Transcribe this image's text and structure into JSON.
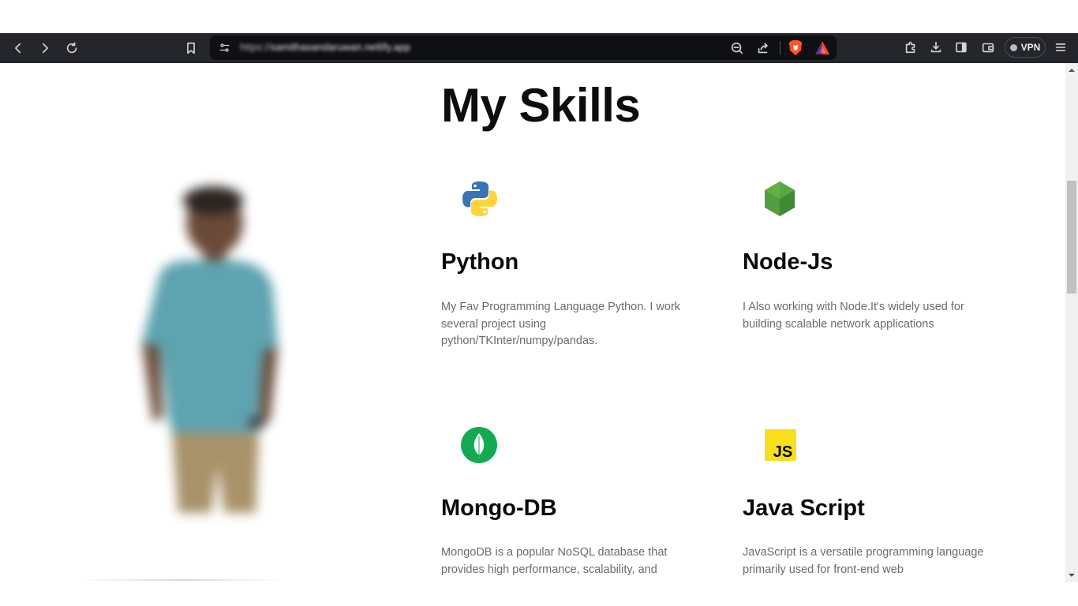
{
  "browser": {
    "url_scheme": "https://",
    "url_host": "samithasandaruwan.netlify.app",
    "vpn_label": "VPN",
    "icons": [
      "back-icon",
      "forward-icon",
      "reload-icon",
      "bookmark-icon",
      "site-settings-icon",
      "zoom-out-icon",
      "share-icon",
      "brave-shields-icon",
      "brave-rewards-icon",
      "extensions-icon",
      "downloads-icon",
      "sidebar-icon",
      "wallet-icon",
      "menu-icon"
    ]
  },
  "page": {
    "heading": "My Skills",
    "skills": [
      {
        "icon": "python-icon",
        "title": "Python",
        "description": "My Fav Programming Language Python. I work several project using python/TKInter/numpy/pandas."
      },
      {
        "icon": "nodejs-icon",
        "title": "Node-Js",
        "description": "I Also working with Node.It's widely used for building scalable network applications"
      },
      {
        "icon": "mongodb-icon",
        "title": "Mongo-DB",
        "description": "MongoDB is a popular NoSQL database that provides high performance, scalability, and"
      },
      {
        "icon": "javascript-icon",
        "title": "Java Script",
        "description": "JavaScript is a versatile programming language primarily used for front-end web",
        "icon_text": "JS"
      }
    ]
  },
  "colors": {
    "toolbar_bg": "#24262b",
    "url_bg": "#0f1013",
    "python_blue": "#3a75b0",
    "python_yellow": "#ffd43b",
    "node_green": "#539e43",
    "mongo_green": "#13aa52",
    "js_yellow": "#f7df1e"
  }
}
